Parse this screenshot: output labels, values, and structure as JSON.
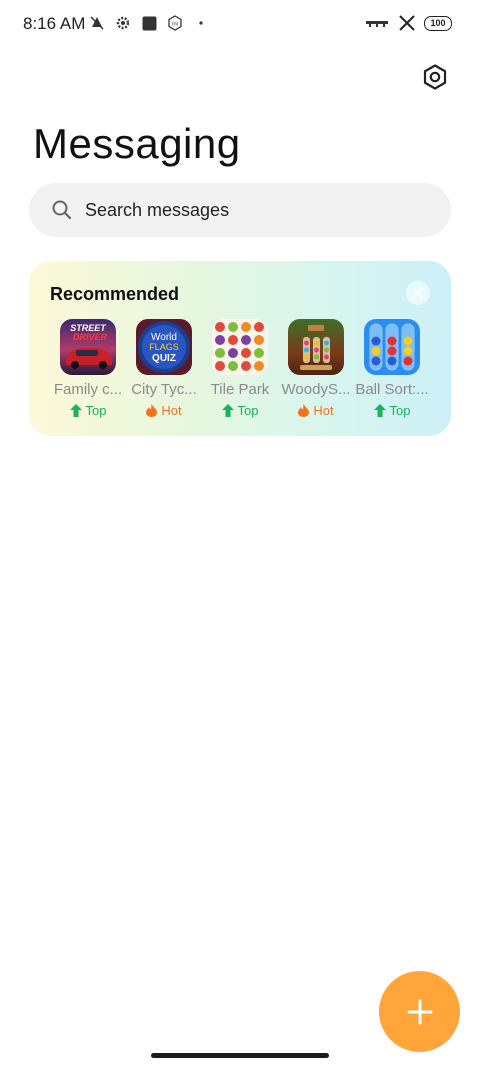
{
  "status_bar": {
    "time": "8:16 AM",
    "battery": "100"
  },
  "header": {
    "title": "Messaging",
    "settings_icon": "settings-hexagon-icon"
  },
  "search": {
    "placeholder": "Search messages"
  },
  "recommended": {
    "title": "Recommended",
    "apps": [
      {
        "name": "Family c...",
        "badge": "Top",
        "badge_type": "top"
      },
      {
        "name": "City Tyc...",
        "badge": "Hot",
        "badge_type": "hot"
      },
      {
        "name": "Tile Park",
        "badge": "Top",
        "badge_type": "top"
      },
      {
        "name": "WoodyS...",
        "badge": "Hot",
        "badge_type": "hot"
      },
      {
        "name": "Ball Sort:...",
        "badge": "Top",
        "badge_type": "top"
      }
    ],
    "icon_texts": {
      "street_driver_1": "STREET",
      "street_driver_2": "DRIVER",
      "world_flags_1": "World",
      "world_flags_2": "FLAGS",
      "world_flags_3": "QUIZ"
    }
  },
  "colors": {
    "accent_fab": "#ffa53a",
    "badge_top": "#19b35a",
    "badge_hot": "#f0731f"
  }
}
